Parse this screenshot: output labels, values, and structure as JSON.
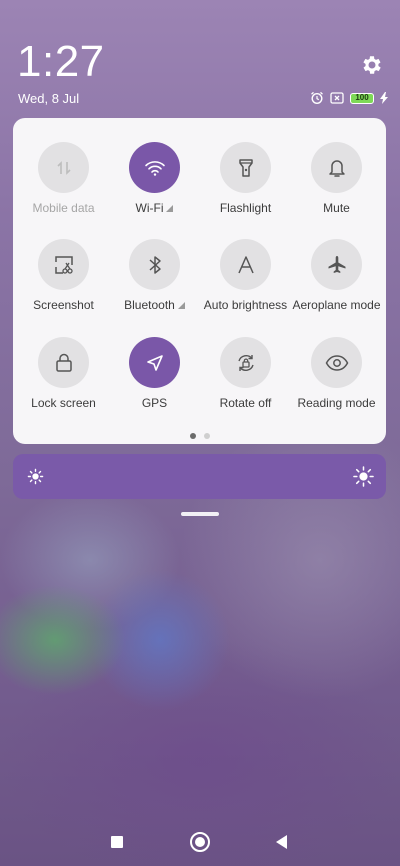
{
  "status": {
    "time": "1:27",
    "date": "Wed, 8 Jul",
    "battery_level": "100",
    "icons": [
      "alarm-icon",
      "no-sim-icon",
      "battery-icon",
      "charging-bolt-icon"
    ]
  },
  "quick_settings": {
    "tiles": [
      {
        "label": "Mobile data",
        "icon": "mobile-data-icon",
        "active": false,
        "disabled": true
      },
      {
        "label": "Wi-Fi",
        "icon": "wifi-icon",
        "active": true,
        "has_arrow": true
      },
      {
        "label": "Flashlight",
        "icon": "flashlight-icon",
        "active": false
      },
      {
        "label": "Mute",
        "icon": "bell-icon",
        "active": false
      },
      {
        "label": "Screenshot",
        "icon": "screenshot-icon",
        "active": false
      },
      {
        "label": "Bluetooth",
        "icon": "bluetooth-icon",
        "active": false,
        "has_arrow": true
      },
      {
        "label": "Auto brightness",
        "icon": "auto-brightness-icon",
        "active": false
      },
      {
        "label": "Aeroplane mode",
        "icon": "airplane-icon",
        "active": false
      },
      {
        "label": "Lock screen",
        "icon": "lock-icon",
        "active": false
      },
      {
        "label": "GPS",
        "icon": "location-arrow-icon",
        "active": true
      },
      {
        "label": "Rotate off",
        "icon": "rotation-lock-icon",
        "active": false
      },
      {
        "label": "Reading mode",
        "icon": "eye-icon",
        "active": false
      }
    ],
    "page_count": 2,
    "current_page": 1
  },
  "brightness": {
    "level_fraction": 1.0,
    "icons": [
      "sun-small-icon",
      "sun-large-icon"
    ]
  },
  "colors": {
    "accent": "#7a57a8",
    "tile_inactive": "#e2e1e3",
    "panel_bg": "#f7f6f8"
  },
  "nav": {
    "buttons": [
      "recents-button",
      "home-button",
      "back-button"
    ]
  }
}
